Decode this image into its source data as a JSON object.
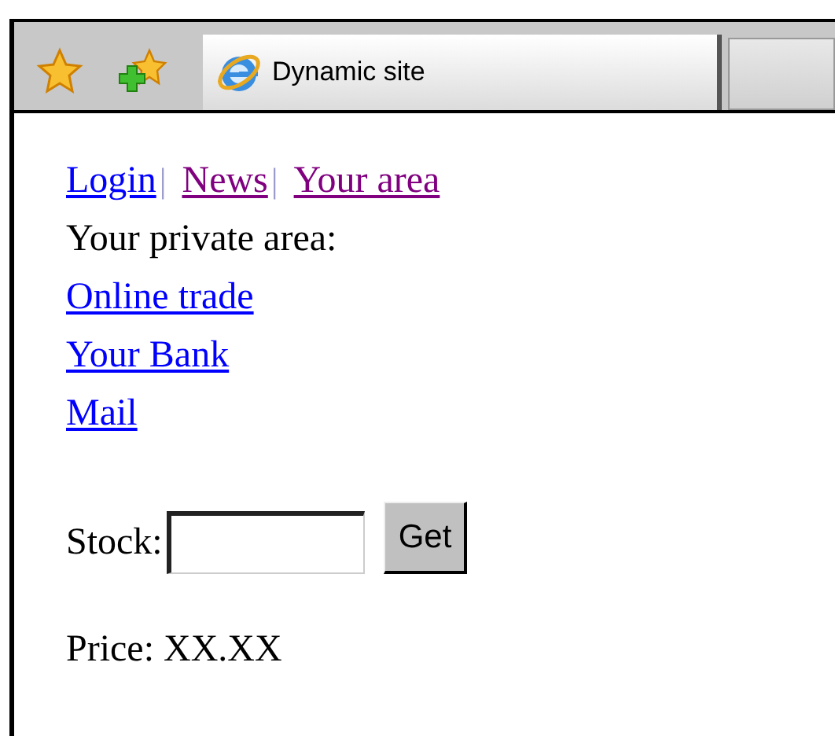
{
  "tabs": [
    {
      "title": "Dynamic site",
      "selected": true
    }
  ],
  "nav_links": [
    {
      "label": "Login",
      "visited": false,
      "separator": "|"
    },
    {
      "label": "News",
      "visited": true,
      "separator": "|"
    },
    {
      "label": "Your area",
      "visited": true
    }
  ],
  "private_area": {
    "heading": "Your private area:",
    "links": [
      {
        "label": "Online trade",
        "visited": false
      },
      {
        "label": "Your Bank",
        "visited": false
      },
      {
        "label": "Mail",
        "visited": false
      }
    ]
  },
  "stock_form": {
    "label": "Stock:",
    "button": "Get"
  },
  "price": "Price: XX.XX"
}
